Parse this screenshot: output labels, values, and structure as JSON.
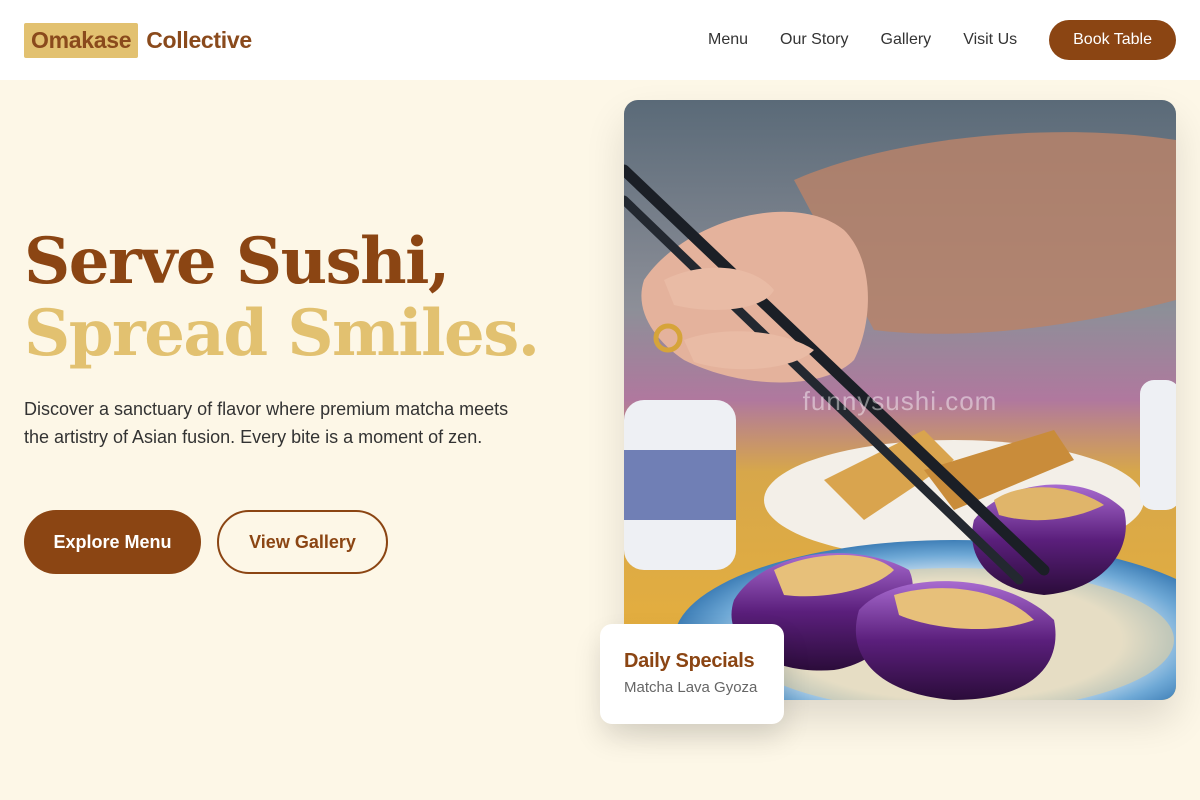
{
  "brand": {
    "logo_part1": "Omakase",
    "logo_part2": "Collective"
  },
  "nav": {
    "items": [
      {
        "label": "Menu"
      },
      {
        "label": "Our Story"
      },
      {
        "label": "Gallery"
      },
      {
        "label": "Visit Us"
      }
    ],
    "cta_label": "Book Table"
  },
  "hero": {
    "title_line1": "Serve Sushi,",
    "title_line2": "Spread Smiles.",
    "description": "Discover a sanctuary of flavor where premium matcha meets the artistry of Asian fusion. Every bite is a moment of zen.",
    "primary_button": "Explore Menu",
    "secondary_button": "View Gallery",
    "image_watermark": "funnysushi.com"
  },
  "special": {
    "title": "Daily Specials",
    "item": "Matcha Lava Gyoza"
  },
  "colors": {
    "brand": "#8b4513",
    "accent": "#e2c170",
    "background": "#fdf7e7"
  }
}
